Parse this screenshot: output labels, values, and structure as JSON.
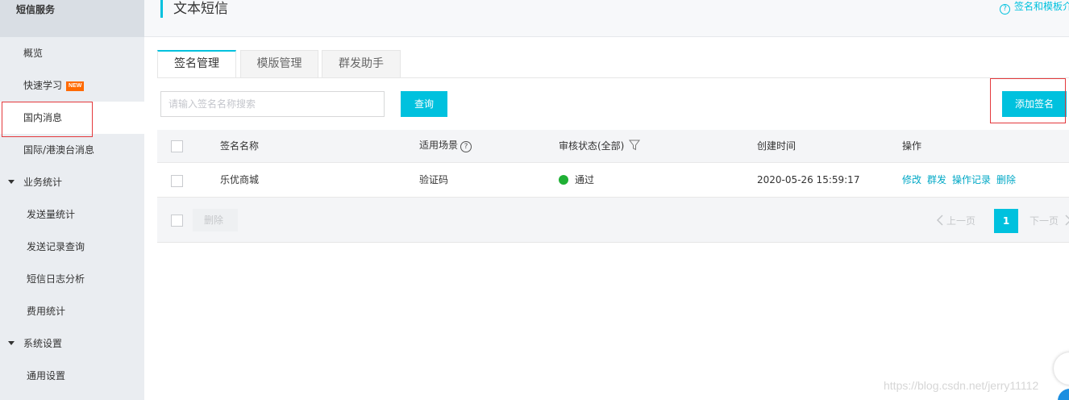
{
  "sidebar": {
    "header": "短信服务",
    "items": [
      {
        "label": "概览"
      },
      {
        "label": "快速学习",
        "badge": "NEW"
      },
      {
        "label": "国内消息"
      },
      {
        "label": "国际/港澳台消息"
      }
    ],
    "groups": [
      {
        "label": "业务统计",
        "children": [
          {
            "label": "发送量统计"
          },
          {
            "label": "发送记录查询"
          },
          {
            "label": "短信日志分析"
          },
          {
            "label": "费用统计"
          }
        ]
      },
      {
        "label": "系统设置",
        "children": [
          {
            "label": "通用设置"
          }
        ]
      }
    ]
  },
  "header": {
    "title": "文本短信",
    "help_text": "签名和模板介"
  },
  "tabs": [
    {
      "label": "签名管理"
    },
    {
      "label": "模版管理"
    },
    {
      "label": "群发助手"
    }
  ],
  "search": {
    "placeholder": "请输入签名名称搜索",
    "query_label": "查询",
    "add_label": "添加签名"
  },
  "table": {
    "columns": [
      "签名名称",
      "适用场景",
      "审核状态(全部)",
      "创建时间",
      "操作"
    ],
    "rows": [
      {
        "name": "乐优商城",
        "scene": "验证码",
        "status": "通过",
        "created": "2020-05-26 15:59:17",
        "actions": [
          "修改",
          "群发",
          "操作记录",
          "删除"
        ]
      }
    ],
    "delete_label": "删除",
    "pager": {
      "prev": "上一页",
      "current": "1",
      "next": "下一页"
    }
  },
  "watermark": "https://blog.csdn.net/jerry11112",
  "colors": {
    "accent": "#00c1de",
    "status_ok": "#1fb035",
    "highlight": "#e4393c"
  },
  "icons": {
    "help": "question-circle-icon",
    "filter": "filter-funnel-icon",
    "caret": "caret-down-icon"
  }
}
